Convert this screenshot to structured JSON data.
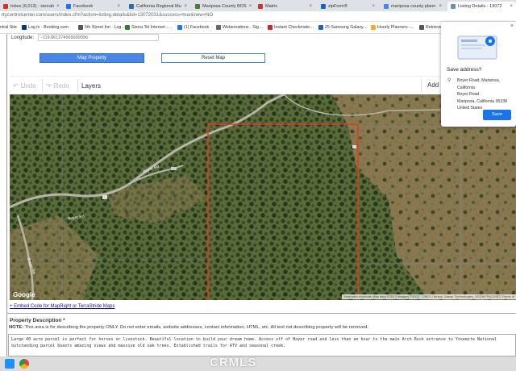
{
  "browser": {
    "tabs": [
      {
        "label": "Inbox (6,013) - sierrah",
        "color": "#d93025"
      },
      {
        "label": "Facebook",
        "color": "#1877f2"
      },
      {
        "label": "California Regional Mu",
        "color": "#2b6cb0"
      },
      {
        "label": "Mariposa County BOS",
        "color": "#4a7c3a"
      },
      {
        "label": "Matrix",
        "color": "#c0392b"
      },
      {
        "label": "zipForm®",
        "color": "#1565c0"
      },
      {
        "label": "mariposa county plann",
        "color": "#4285f4"
      },
      {
        "label": "Listing Details - 13072",
        "color": "#6d8fb0"
      }
    ],
    "url": "rtycontrolcenter.com/users/index.cfm?action=listing.details&lid=13072031&success=true&new=NO",
    "bookmarks": [
      {
        "label": "ntral Site",
        "color": "#888"
      },
      {
        "label": "Log in · Booking.com",
        "color": "#003580"
      },
      {
        "label": "5th Street Inn · Log…",
        "color": "#555"
      },
      {
        "label": "Sierra Tel Internet -…",
        "color": "#2e7d32"
      },
      {
        "label": "(1) Facebook",
        "color": "#1877f2"
      },
      {
        "label": "Webernations · Sig…",
        "color": "#666"
      },
      {
        "label": "Instant Checkmate…",
        "color": "#c62828"
      },
      {
        "label": "25 Samsung Galaxy…",
        "color": "#1565c0"
      },
      {
        "label": "Hourly Planners -…",
        "color": "#f9a825"
      },
      {
        "label": "Retrieve",
        "color": "#555"
      }
    ]
  },
  "form": {
    "longitude_label": "Longitude:",
    "longitude_value": "-119.861374999999996",
    "map_property_button": "Map Property",
    "reset_map_button": "Reset Map"
  },
  "map_toolbar": {
    "undo": "Undo",
    "redo": "Redo",
    "layers": "Layers",
    "add_home": "Add H"
  },
  "map": {
    "road_label": "Boyer Rd",
    "road_label_2": "Boyer Rd",
    "road_label_3": "Boyer Rd",
    "google_logo": "Google",
    "attribution": "Keyboard shortcuts   Map data ©2023 Imagery ©2023 , CNES / Airbus, Maxar Technologies, USDA/FPAC/GEO   Terms of",
    "parcel_color": "#e8381c"
  },
  "embed_link": "+ Embed Code for MapRight or TerraStride Maps",
  "property_description": {
    "title": "Property Description *",
    "note_bold": "NOTE:",
    "note_text": " This area is for describing the property ONLY. Do not enter emails, website addresses, contact information, HTML, etc. All text not describing property will be removed.",
    "text_line_1": "Large 40 acre parcel is perfect for horses or livestock. Beautiful location to build your dream home. Access off of Boyer road and less than an hour to the main Arch Rock entrance to Yosemite National",
    "text_line_2": "outstanding parcel boasts amazing views and massive old oak trees. Established trails for ATV and seasonal creek."
  },
  "save_popup": {
    "title": "Save address?",
    "address_lines": [
      "Boyer Road, Mariposa, California",
      "Boyer Road",
      "Mariposa, California 95338",
      "United States"
    ],
    "save_button": "Save",
    "accent": "#1a73e8"
  },
  "watermark": "CRMLS"
}
